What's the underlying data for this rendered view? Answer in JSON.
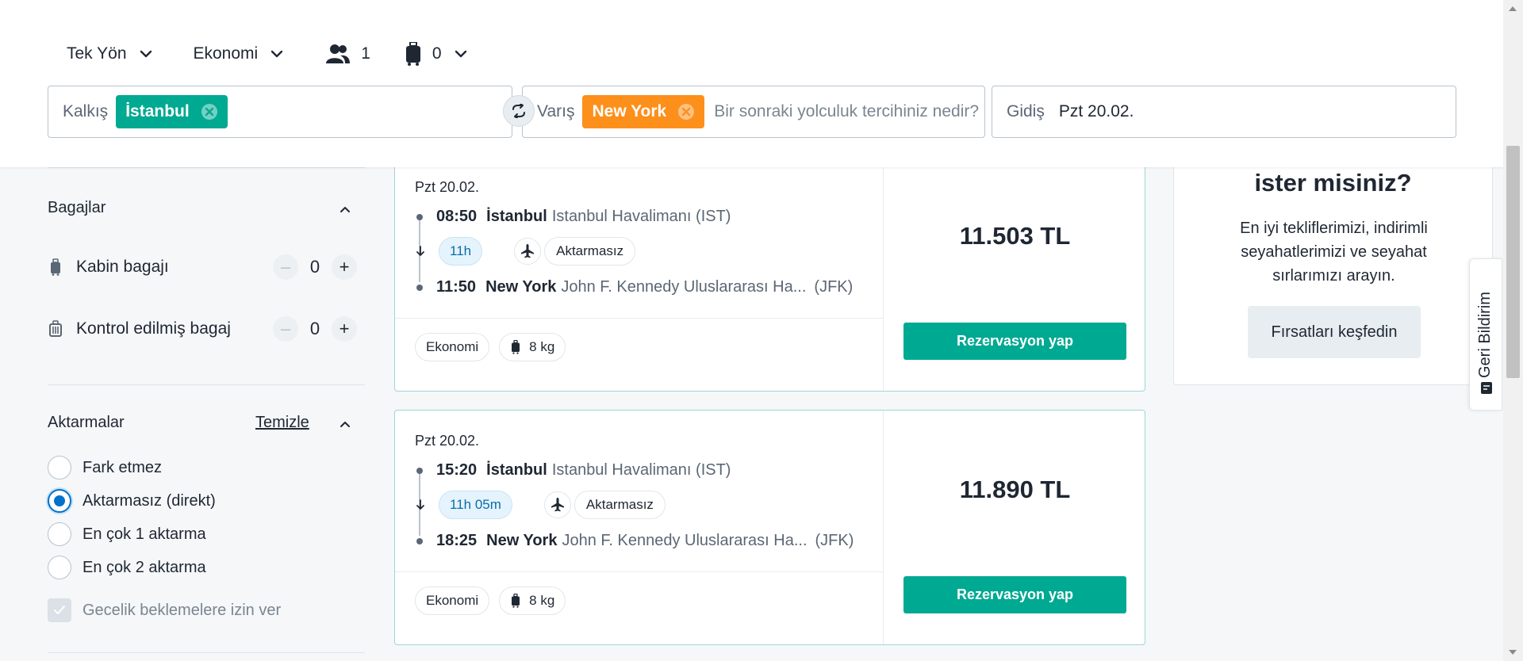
{
  "header": {
    "trip_type": "Tek Yön",
    "cabin_class": "Ekonomi",
    "passengers": "1",
    "bags": "0",
    "from_label": "Kalkış",
    "from_chip": "İstanbul",
    "to_label": "Varış",
    "to_chip": "New York",
    "to_placeholder": "Bir sonraki yolculuk tercihiniz nedir?",
    "depart_label": "Gidiş",
    "depart_value": "Pzt 20.02."
  },
  "sidebar": {
    "bags_title": "Bagajlar",
    "cabin_bag_label": "Kabin bagajı",
    "cabin_bag_value": "0",
    "checked_bag_label": "Kontrol edilmiş bagaj",
    "checked_bag_value": "0",
    "stops_title": "Aktarmalar",
    "clear_label": "Temizle",
    "stops_options": [
      "Fark etmez",
      "Aktarmasız (direkt)",
      "En çok 1 aktarma",
      "En çok 2 aktarma"
    ],
    "stops_selected": "Aktarmasız (direkt)",
    "overnight_label": "Gecelik beklemelere izin ver"
  },
  "flights": [
    {
      "date": "Pzt 20.02.",
      "dep_time": "08:50",
      "dep_city": "İstanbul",
      "dep_airport": "Istanbul Havalimanı (IST)",
      "duration": "11h",
      "stops": "Aktarmasız",
      "arr_time": "11:50",
      "arr_city": "New York",
      "arr_airport": "John F. Kennedy Uluslararası Ha...",
      "arr_code": "(JFK)",
      "fare_class": "Ekonomi",
      "baggage": "8 kg",
      "price": "11.503 TL",
      "book_label": "Rezervasyon yap"
    },
    {
      "date": "Pzt 20.02.",
      "dep_time": "15:20",
      "dep_city": "İstanbul",
      "dep_airport": "Istanbul Havalimanı (IST)",
      "duration": "11h 05m",
      "stops": "Aktarmasız",
      "arr_time": "18:25",
      "arr_city": "New York",
      "arr_airport": "John F. Kennedy Uluslararası Ha...",
      "arr_code": "(JFK)",
      "fare_class": "Ekonomi",
      "baggage": "8 kg",
      "price": "11.890 TL",
      "book_label": "Rezervasyon yap"
    }
  ],
  "promo": {
    "title": "ister misiniz?",
    "text": "En iyi tekliflerimizi, indirimli seyahatlerimizi ve seyahat sırlarımızı arayın.",
    "button": "Fırsatları keşfedin"
  },
  "feedback_label": "Geri Bildirim",
  "colors": {
    "brand_green": "#00a991",
    "destination_orange": "#fd8f1b",
    "radio_blue": "#0172cb"
  }
}
